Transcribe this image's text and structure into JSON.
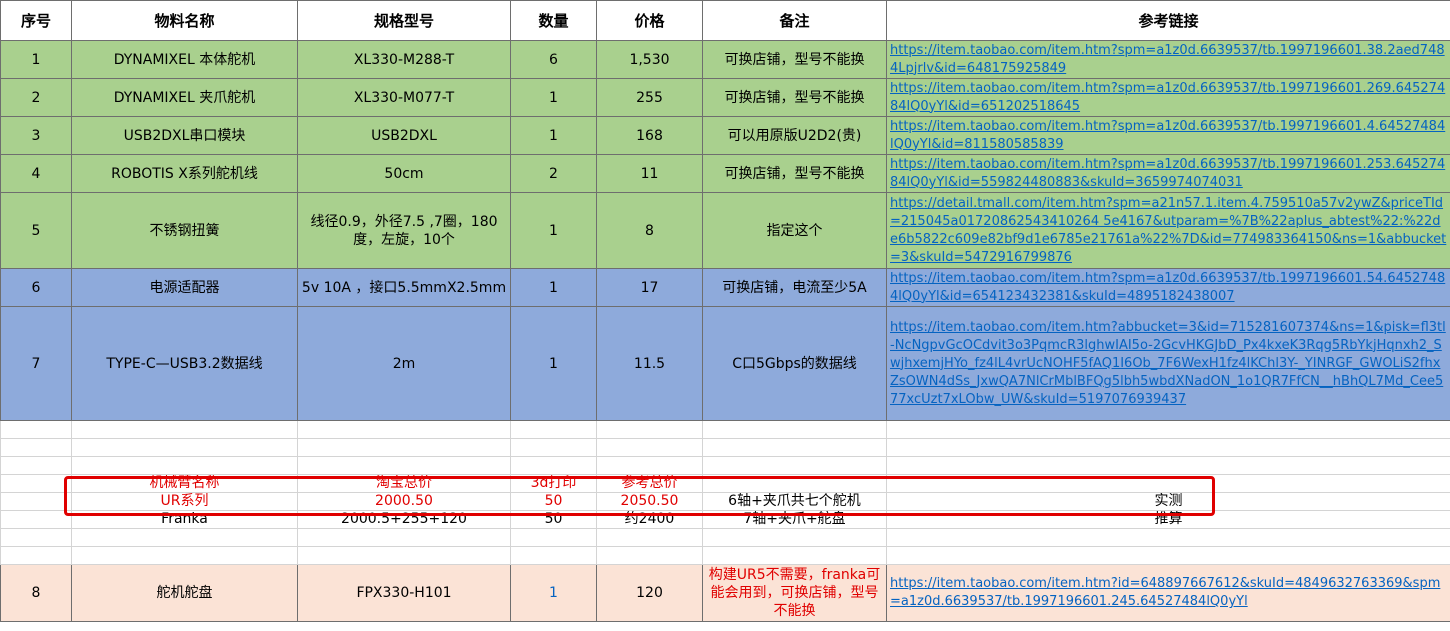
{
  "headers": [
    "序号",
    "物料名称",
    "规格型号",
    "数量",
    "价格",
    "备注",
    "参考链接"
  ],
  "rows": [
    {
      "no": "1",
      "name": "DYNAMIXEL 本体舵机",
      "spec": "XL330-M288-T",
      "qty": "6",
      "price": "1,530",
      "note": "可换店铺，型号不能换",
      "link": "https://item.taobao.com/item.htm?spm=a1z0d.6639537/tb.1997196601.38.2aed7484Lpjrlv&id=648175925849"
    },
    {
      "no": "2",
      "name": "DYNAMIXEL 夹爪舵机",
      "spec": "XL330-M077-T",
      "qty": "1",
      "price": "255",
      "note": "可换店铺，型号不能换",
      "link": "https://item.taobao.com/item.htm?spm=a1z0d.6639537/tb.1997196601.269.64527484lQ0yYl&id=651202518645"
    },
    {
      "no": "3",
      "name": "USB2DXL串口模块",
      "spec": "USB2DXL",
      "qty": "1",
      "price": "168",
      "note": "可以用原版U2D2(贵)",
      "link": "https://item.taobao.com/item.htm?spm=a1z0d.6639537/tb.1997196601.4.64527484lQ0yYl&id=811580585839"
    },
    {
      "no": "4",
      "name": "ROBOTIS X系列舵机线",
      "spec": "50cm",
      "qty": "2",
      "price": "11",
      "note": "可换店铺，型号不能换",
      "link": "https://item.taobao.com/item.htm?spm=a1z0d.6639537/tb.1997196601.253.64527484lQ0yYl&id=559824480883&skuId=3659974074031"
    },
    {
      "no": "5",
      "name": "不锈钢扭簧",
      "spec": "线径0.9，外径7.5 ,7圈，180度，左旋，10个",
      "qty": "1",
      "price": "8",
      "note": "指定这个",
      "link": "https://detail.tmall.com/item.htm?spm=a21n57.1.item.4.759510a57v2ywZ&priceTId=215045a01720862543410264 5e4167&utparam=%7B%22aplus_abtest%22:%22de6b5822c609e82bf9d1e6785e21761a%22%7D&id=774983364150&ns=1&abbucket=3&skuId=5472916799876"
    },
    {
      "no": "6",
      "name": "电源适配器",
      "spec": "5v 10A ，接口5.5mmX2.5mm",
      "qty": "1",
      "price": "17",
      "note": "可换店铺，电流至少5A",
      "link": "https://item.taobao.com/item.htm?spm=a1z0d.6639537/tb.1997196601.54.64527484lQ0yYl&id=654123432381&skuId=4895182438007"
    },
    {
      "no": "7",
      "name": "TYPE-C—USB3.2数据线",
      "spec": "2m",
      "qty": "1",
      "price": "11.5",
      "note": "C口5Gbps的数据线",
      "link": "https://item.taobao.com/item.htm?abbucket=3&id=715281607374&ns=1&pisk=fl3tl-NcNgpvGcOCdvit3o3PqmcR3lghwIAI5o-2GcvHKGJbD_Px4kxeK3Rqg5RbYkjHqnxh2_SwjhxemjHYo_fz4lL4vrUcNOHF5fAQ1I6Ob_7F6WexH1fz4lKChl3Y-_YINRGF_GWOLiS2fhxZsOWN4dSs_JxwQA7NlCrMblBFQg5lbh5wbdXNadON_1o1QR7FfCN__hBhQL7Md_Cee577xcUzt7xLObw_UW&skuId=5197076939437"
    },
    {
      "no": "8",
      "name": "舵机舵盘",
      "spec": "FPX330-H101",
      "qty": "1",
      "price": "120",
      "note": "构建UR5不需要，franka可能会用到，可换店铺，型号不能换",
      "link": "https://item.taobao.com/item.htm?id=648897667612&skuId=4849632763369&spm=a1z0d.6639537/tb.1997196601.245.64527484lQ0yYl"
    }
  ],
  "summary": {
    "headers": [
      "机械臂名称",
      "淘宝总价",
      "3d打印",
      "参考总价"
    ],
    "ur": {
      "name": "UR系列",
      "taobao": "2000.50",
      "print3d": "50",
      "total": "2050.50",
      "note": "6轴+夹爪共七个舵机",
      "tag": "实测"
    },
    "franka": {
      "name": "Franka",
      "taobao": "2000.5+255+120",
      "print3d": "50",
      "total": "约2400",
      "note": "7轴+夹爪+舵盘",
      "tag": "推算"
    }
  },
  "colors": {
    "green_rows": "#a9d08e",
    "blue_rows": "#8eaadb",
    "pink_row": "#fbe3d6",
    "link": "#0563c1",
    "highlight": "#e00000"
  }
}
